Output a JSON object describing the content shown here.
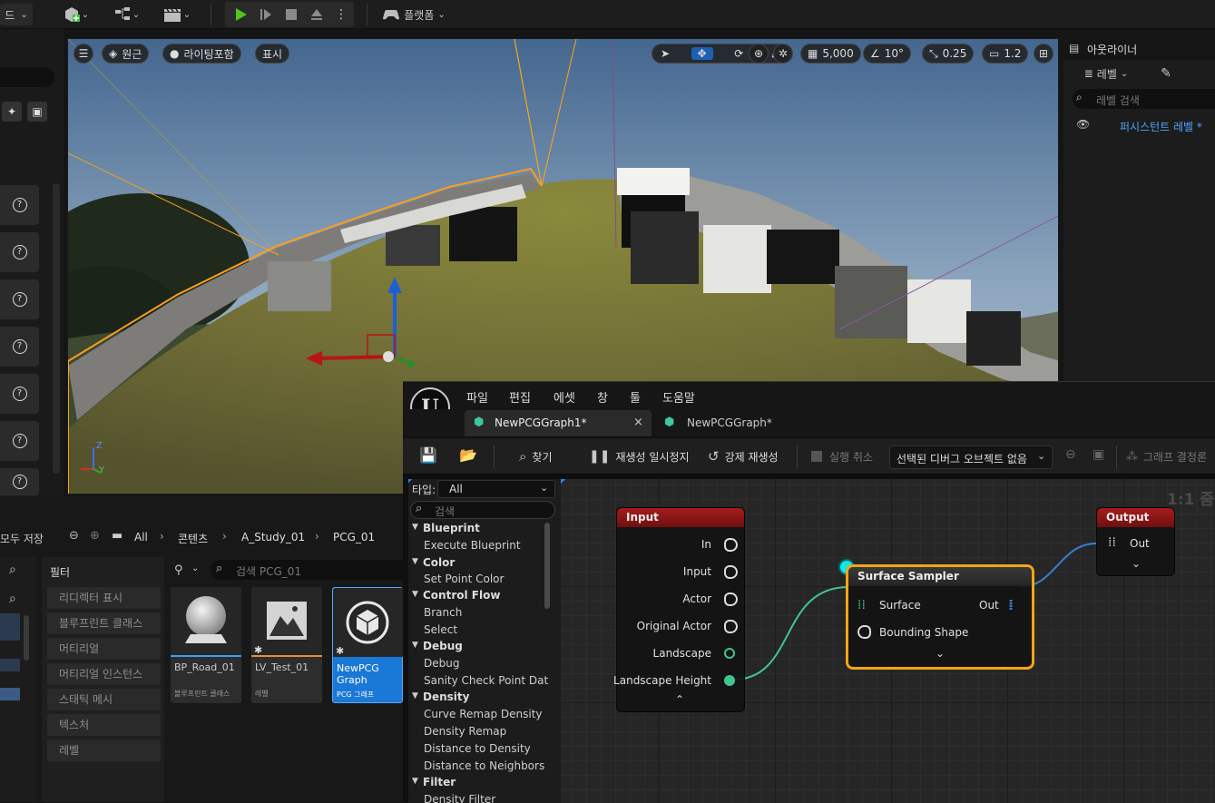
{
  "toolbar": {
    "left_cut_label": "드",
    "platform_label": "플랫폼"
  },
  "viewport": {
    "perspective_label": "원근",
    "lighting_label": "라이팅포함",
    "show_label": "표시",
    "grid_value": "5,000",
    "angle_value": "10°",
    "scale_value": "0.25",
    "camera_speed": "1.2",
    "axis_z": "Z",
    "axis_y": "Y"
  },
  "outliner": {
    "title": "아웃라이너",
    "level_label": "레벨",
    "search_placeholder": "레벨 검색",
    "persistent_level": "퍼시스턴트 레벨 *"
  },
  "content_browser": {
    "save_all": "모두 저장",
    "breadcrumb": [
      "All",
      "콘텐츠",
      "A_Study_01",
      "PCG_01"
    ],
    "filter_title": "필터",
    "search_placeholder": "검색 PCG_01",
    "filters": [
      "리디렉터 표시",
      "블루프린트 클래스",
      "머티리얼",
      "머티리얼 인스턴스",
      "스태틱 메시",
      "텍스처",
      "레벨"
    ],
    "assets": [
      {
        "name": "BP_Road_01",
        "type": "블루프린트 클래스",
        "accent": "#3e9cff"
      },
      {
        "name": "LV_Test_01",
        "type": "레벨",
        "accent": "#e6902e"
      },
      {
        "name": "NewPCG Graph",
        "type": "PCG 그래프",
        "accent": "#1e88e5"
      }
    ]
  },
  "pcg_editor": {
    "menu": [
      "파일",
      "편집",
      "에셋",
      "창",
      "툴",
      "도움말"
    ],
    "tabs": [
      {
        "label": "NewPCGGraph1*",
        "active": true
      },
      {
        "label": "NewPCGGraph*",
        "active": false
      }
    ],
    "close_glyph": "×",
    "tools": {
      "find": "찾기",
      "pause": "재생성 일시정지",
      "force": "강제 재생성",
      "cancel": "실행 취소",
      "debug_object": "선택된 디버그 오브젝트 없음",
      "graph_settings": "그래프 결정론"
    },
    "palette": {
      "type_label": "타입:",
      "type_value": "All",
      "search_placeholder": "검색",
      "groups": [
        {
          "category": "Blueprint",
          "items": [
            "Execute Blueprint"
          ]
        },
        {
          "category": "Color",
          "items": [
            "Set Point Color"
          ]
        },
        {
          "category": "Control Flow",
          "items": [
            "Branch",
            "Select"
          ]
        },
        {
          "category": "Debug",
          "items": [
            "Debug",
            "Sanity Check Point Dat"
          ]
        },
        {
          "category": "Density",
          "items": [
            "Curve Remap Density",
            "Density Remap",
            "Distance to Density",
            "Distance to Neighbors"
          ]
        },
        {
          "category": "Filter",
          "items": [
            "Density Filter"
          ]
        }
      ]
    },
    "graph": {
      "zoom_label": "1:1 줌",
      "input_node": {
        "title": "Input",
        "pins": [
          "In",
          "Input",
          "Actor",
          "Original Actor",
          "Landscape",
          "Landscape Height"
        ]
      },
      "sampler_node": {
        "title": "Surface Sampler",
        "in_pins": [
          "Surface",
          "Bounding Shape"
        ],
        "out_pin": "Out"
      },
      "output_node": {
        "title": "Output",
        "in_pin": "Out"
      },
      "colors": {
        "input_header": "#8c1616",
        "output_header": "#8c1616",
        "sampler_border": "#f2a516",
        "wire": "#3fc58d",
        "wire_out": "#3b7dd8"
      }
    }
  }
}
